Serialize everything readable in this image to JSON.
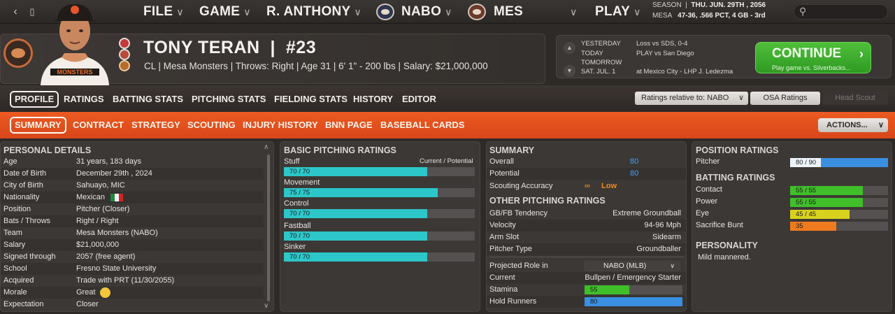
{
  "topbar": {
    "menus": [
      {
        "label": "FILE"
      },
      {
        "label": "GAME"
      },
      {
        "label": "R. ANTHONY"
      },
      {
        "label": "NABO"
      },
      {
        "label": "MES"
      },
      {
        "label": "PLAY"
      }
    ],
    "season_line": "SEASON",
    "season_date": "THU. JUN. 29TH , 2056",
    "team_line": "MESA",
    "team_record": "47-36, .566 PCT, 4 GB - 3rd"
  },
  "player": {
    "name": "TONY TERAN",
    "number": "#23",
    "info": "CL | Mesa Monsters  |  Throws: Right  |  Age 31  |  6' 1\" - 200 lbs  |  Salary: $21,000,000"
  },
  "schedule": {
    "yesterday_label": "YESTERDAY",
    "yesterday_value": "Loss vs SDS, 0-4",
    "today_label": "TODAY",
    "today_value": "PLAY vs San Diego",
    "tomorrow_label": "TOMORROW",
    "next_label": "SAT. JUL. 1",
    "next_value": "at Mexico City - LHP J. Ledezma"
  },
  "continue_btn": {
    "title": "CONTINUE",
    "subtitle": "Play game vs. Silverbacks..."
  },
  "tabs1": [
    {
      "label": "PROFILE"
    },
    {
      "label": "RATINGS"
    },
    {
      "label": "BATTING STATS"
    },
    {
      "label": "PITCHING STATS"
    },
    {
      "label": "FIELDING STATS"
    },
    {
      "label": "HISTORY"
    },
    {
      "label": "EDITOR"
    }
  ],
  "ratings_relative": "Ratings relative to: NABO",
  "osa_ratings": "OSA Ratings",
  "head_scout": "Head Scout",
  "tabs2": [
    {
      "label": "SUMMARY"
    },
    {
      "label": "CONTRACT"
    },
    {
      "label": "STRATEGY"
    },
    {
      "label": "SCOUTING"
    },
    {
      "label": "INJURY HISTORY"
    },
    {
      "label": "BNN PAGE"
    },
    {
      "label": "BASEBALL CARDS"
    }
  ],
  "actions": "ACTIONS...",
  "personal": {
    "title": "PERSONAL DETAILS",
    "rows": [
      {
        "k": "Age",
        "v": "31 years, 183 days"
      },
      {
        "k": "Date of Birth",
        "v": "December 29th , 2024"
      },
      {
        "k": "City of Birth",
        "v": "Sahuayo, MIC"
      },
      {
        "k": "Nationality",
        "v": "Mexican"
      },
      {
        "k": "Position",
        "v": "Pitcher (Closer)"
      },
      {
        "k": "Bats / Throws",
        "v": "Right / Right"
      },
      {
        "k": "Team",
        "v": "Mesa Monsters (NABO)"
      },
      {
        "k": "Salary",
        "v": "$21,000,000"
      },
      {
        "k": "Signed through",
        "v": "2057 (free agent)"
      },
      {
        "k": "School",
        "v": "Fresno State University"
      },
      {
        "k": "Acquired",
        "v": "Trade with PRT (11/30/2055)"
      },
      {
        "k": "Morale",
        "v": "Great"
      },
      {
        "k": "Expectation",
        "v": "Closer"
      }
    ]
  },
  "pitching": {
    "title": "BASIC PITCHING RATINGS",
    "header": "Current / Potential",
    "ratings": [
      {
        "name": "Stuff",
        "label": "70 / 70",
        "current": 70,
        "potential": 70
      },
      {
        "name": "Movement",
        "label": "75 / 75",
        "current": 75,
        "potential": 75
      },
      {
        "name": "Control",
        "label": "70 / 70",
        "current": 70,
        "potential": 70
      },
      {
        "name": "Fastball",
        "label": "70 / 70",
        "current": 70,
        "potential": 70
      },
      {
        "name": "Sinker",
        "label": "70 / 70",
        "current": 70,
        "potential": 70
      }
    ]
  },
  "summary": {
    "title": "SUMMARY",
    "overall_label": "Overall",
    "overall": "80",
    "potential_label": "Potential",
    "potential": "80",
    "scouting_label": "Scouting Accuracy",
    "scouting": "Low",
    "other_title": "OTHER PITCHING RATINGS",
    "rows": [
      {
        "k": "GB/FB Tendency",
        "v": "Extreme Groundball"
      },
      {
        "k": "Velocity",
        "v": "94-96 Mph"
      },
      {
        "k": "Arm Slot",
        "v": "Sidearm"
      },
      {
        "k": "Pitcher Type",
        "v": "Groundballer"
      }
    ],
    "projected_label": "Projected Role in",
    "projected_value": "NABO (MLB)",
    "current_label": "Current",
    "current_value": "Bullpen / Emergency Starter",
    "stamina_label": "Stamina",
    "stamina": 55,
    "hold_label": "Hold Runners",
    "hold": 80
  },
  "position_ratings": {
    "title": "POSITION RATINGS",
    "pitcher_label": "Pitcher",
    "pitcher_text": "80 / 90",
    "pitcher_current": 80,
    "pitcher_potential": 90
  },
  "batting": {
    "title": "BATTING RATINGS",
    "ratings": [
      {
        "name": "Contact",
        "label": "55 / 55",
        "current": 55,
        "potential": 55,
        "color": "#3fbf2a"
      },
      {
        "name": "Power",
        "label": "55 / 55",
        "current": 55,
        "potential": 55,
        "color": "#3fbf2a"
      },
      {
        "name": "Eye",
        "label": "45 / 45",
        "current": 45,
        "potential": 45,
        "color": "#d8d21f"
      },
      {
        "name": "Sacrifice Bunt",
        "label": "35",
        "current": 35,
        "potential": 35,
        "color": "#f07a1e"
      }
    ]
  },
  "personality": {
    "title": "PERSONALITY",
    "text": "Mild mannered."
  },
  "colors": {
    "accent": "#e8521c",
    "teal": "#2ec7c9",
    "blue": "#3a8fe0",
    "green": "#3fbf2a"
  }
}
